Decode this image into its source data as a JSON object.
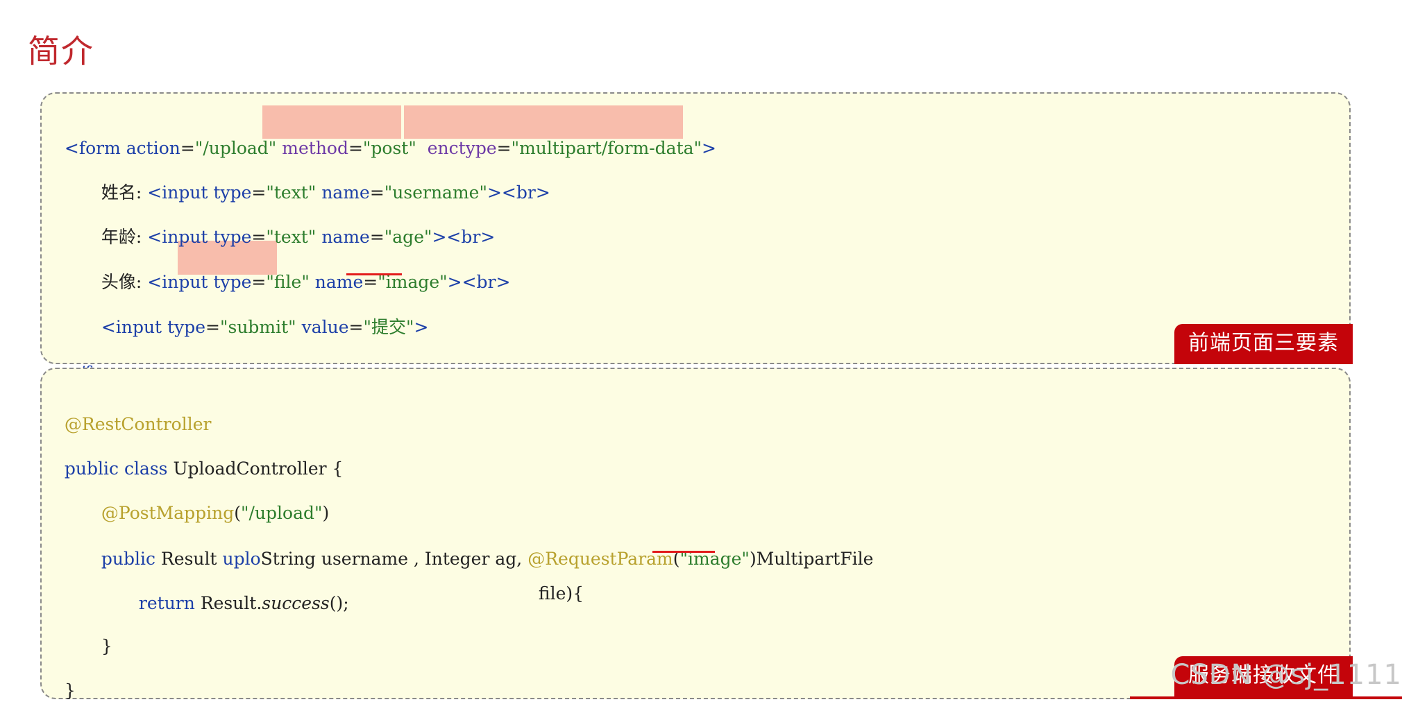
{
  "title": "简介",
  "frontend": {
    "badge": "前端页面三要素",
    "lines": {
      "l1": {
        "a": "<form ",
        "b": "action",
        "c": "=",
        "d": "\"/upload\"",
        "e": " ",
        "f": "method",
        "g": "=",
        "h": "\"post\"",
        "i": "  ",
        "j": "enctype",
        "k": "=",
        "l": "\"multipart/form-data\"",
        "m": ">"
      },
      "l2": {
        "a": "姓名: ",
        "b": "<input ",
        "c": "type",
        "d": "=",
        "e": "\"text\"",
        "f": " ",
        "g": "name",
        "h": "=",
        "i": "\"username\"",
        "j": "><br>"
      },
      "l3": {
        "a": "年龄: ",
        "b": "<input ",
        "c": "type",
        "d": "=",
        "e": "\"text\"",
        "f": " ",
        "g": "name",
        "h": "=",
        "i": "\"age\"",
        "j": "><br>"
      },
      "l4": {
        "a": "头像: ",
        "b": "<input ",
        "c": "type",
        "d": "=",
        "e": "\"file\"",
        "f": " ",
        "g": "name",
        "h": "=",
        "i": "\"image\"",
        "j": "><br>"
      },
      "l5": {
        "a": "<input ",
        "b": "type",
        "c": "=",
        "d": "\"submit\"",
        "e": " ",
        "f": "value",
        "g": "=",
        "h": "\"提交\"",
        "i": ">"
      },
      "l6": {
        "a": "</form>"
      }
    }
  },
  "backend": {
    "badge": "服务端接收文件",
    "lines": {
      "l1": {
        "a": "@RestController"
      },
      "l2": {
        "a": "public class ",
        "b": "UploadController {"
      },
      "l3": {
        "a": "@PostMapping",
        "b": "(",
        "c": "\"/upload\"",
        "d": ")"
      },
      "l4": {
        "a": "public ",
        "b": "Result ",
        "c": "uplo",
        "d": "String username , Integer ag",
        "e": ", ",
        "f": "@RequestParam",
        "g": "(",
        "h": "\"image\"",
        "i": ")MultipartFile"
      },
      "l4b": {
        "a": "file){"
      },
      "l5": {
        "a": "return ",
        "b": "Result.",
        "c": "success",
        "d": "();"
      },
      "l6": {
        "a": "}"
      },
      "l7": {
        "a": "}"
      }
    }
  },
  "watermark": "CSDN @sj_1111",
  "colors": {
    "title": "#c0282d",
    "box_bg": "#fdfde3",
    "badge_bg": "#c4040a",
    "highlight": "#f7b6a5",
    "underline": "#e21b1b",
    "keyword": "#1c3fa8",
    "string": "#2d7d2d",
    "annotation": "#b8a12e"
  }
}
